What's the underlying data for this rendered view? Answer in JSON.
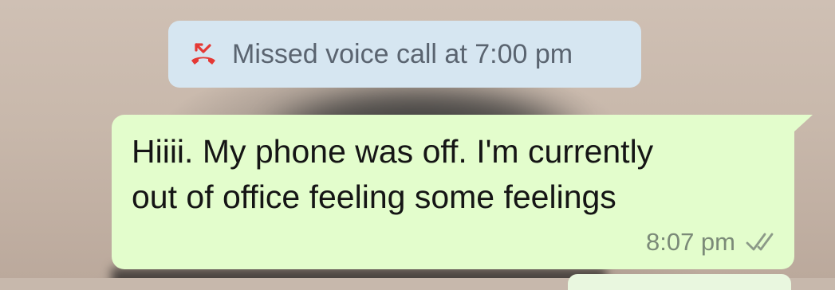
{
  "system_message": {
    "icon": "missed-call-icon",
    "icon_color": "#e53935",
    "text": "Missed voice call at 7:00 pm",
    "background": "#d6e6f1"
  },
  "message": {
    "direction": "outgoing",
    "lines": [
      "Hiiii. My phone was off. I'm currently",
      "out of office feeling some feelings"
    ],
    "time": "8:07 pm",
    "status_icon": "double-check-icon",
    "background": "#e3fdcc"
  }
}
